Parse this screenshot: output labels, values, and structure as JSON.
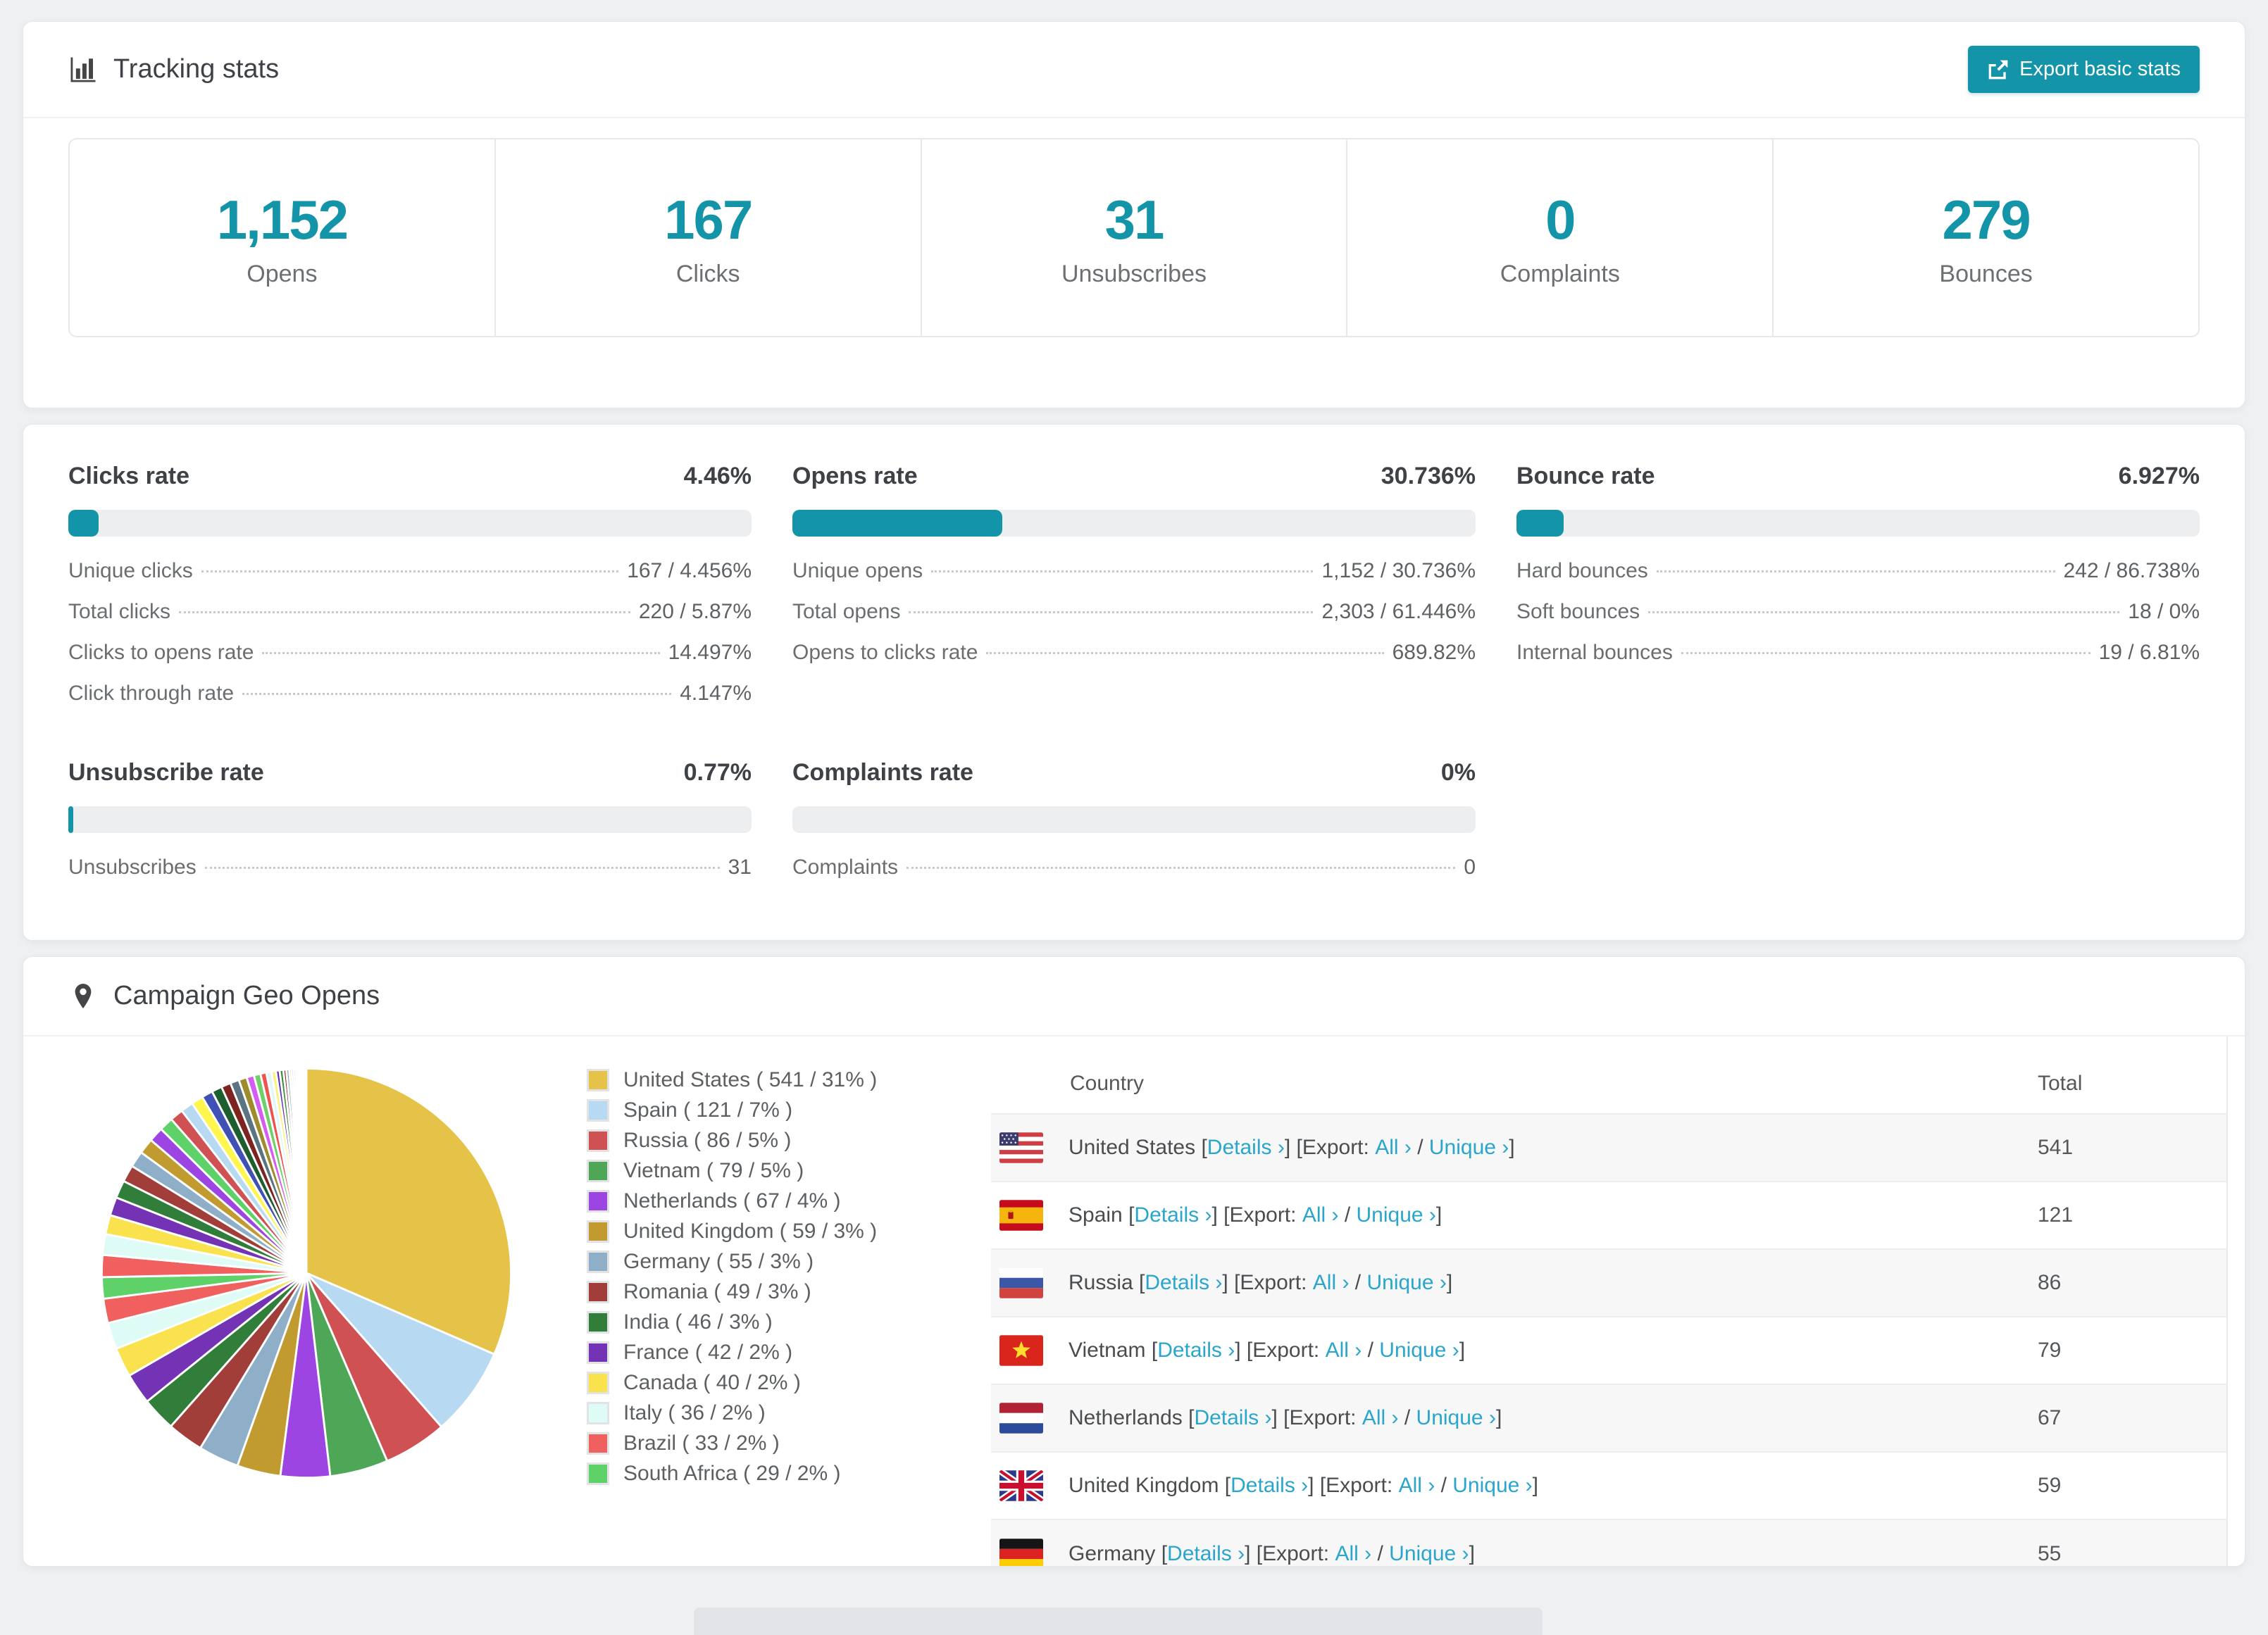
{
  "colors": {
    "accent": "#1494a9",
    "link": "#2aa5cb"
  },
  "header": {
    "title": "Tracking stats",
    "export_label": "Export basic stats"
  },
  "stats": [
    {
      "value": "1,152",
      "label": "Opens"
    },
    {
      "value": "167",
      "label": "Clicks"
    },
    {
      "value": "31",
      "label": "Unsubscribes"
    },
    {
      "value": "0",
      "label": "Complaints"
    },
    {
      "value": "279",
      "label": "Bounces"
    }
  ],
  "rates": {
    "clicks": {
      "title": "Clicks rate",
      "value": "4.46%",
      "pct": 4.46,
      "rows": [
        {
          "label": "Unique clicks",
          "value": "167 / 4.456%"
        },
        {
          "label": "Total clicks",
          "value": "220 / 5.87%"
        },
        {
          "label": "Clicks to opens rate",
          "value": "14.497%"
        },
        {
          "label": "Click through rate",
          "value": "4.147%"
        }
      ]
    },
    "opens": {
      "title": "Opens rate",
      "value": "30.736%",
      "pct": 30.736,
      "rows": [
        {
          "label": "Unique opens",
          "value": "1,152 / 30.736%"
        },
        {
          "label": "Total opens",
          "value": "2,303 / 61.446%"
        },
        {
          "label": "Opens to clicks rate",
          "value": "689.82%"
        }
      ]
    },
    "bounces": {
      "title": "Bounce rate",
      "value": "6.927%",
      "pct": 6.927,
      "rows": [
        {
          "label": "Hard bounces",
          "value": "242 / 86.738%"
        },
        {
          "label": "Soft bounces",
          "value": "18 / 0%"
        },
        {
          "label": "Internal bounces",
          "value": "19 / 6.81%"
        }
      ]
    },
    "unsubscribe": {
      "title": "Unsubscribe rate",
      "value": "0.77%",
      "pct": 0.77,
      "rows": [
        {
          "label": "Unsubscribes",
          "value": "31"
        }
      ]
    },
    "complaints": {
      "title": "Complaints rate",
      "value": "0%",
      "pct": 0,
      "rows": [
        {
          "label": "Complaints",
          "value": "0"
        }
      ]
    }
  },
  "geo": {
    "title": "Campaign Geo Opens",
    "table": {
      "columns": [
        "Country",
        "Total"
      ],
      "details_label": "Details",
      "export_label": "Export:",
      "all_label": "All",
      "unique_label": "Unique",
      "rows": [
        {
          "code": "us",
          "country": "United States",
          "total": "541"
        },
        {
          "code": "es",
          "country": "Spain",
          "total": "121"
        },
        {
          "code": "ru",
          "country": "Russia",
          "total": "86"
        },
        {
          "code": "vn",
          "country": "Vietnam",
          "total": "79"
        },
        {
          "code": "nl",
          "country": "Netherlands",
          "total": "67"
        },
        {
          "code": "gb",
          "country": "United Kingdom",
          "total": "59"
        },
        {
          "code": "de",
          "country": "Germany",
          "total": "55"
        }
      ]
    }
  },
  "chart_data": {
    "type": "pie",
    "title": "Campaign Geo Opens",
    "legend_position": "right",
    "start_angle": "top, clockwise",
    "slices": [
      {
        "label": "United States",
        "value": 541,
        "pct": 31,
        "color": "#e5c348"
      },
      {
        "label": "Spain",
        "value": 121,
        "pct": 7,
        "color": "#b7d9f2"
      },
      {
        "label": "Russia",
        "value": 86,
        "pct": 5,
        "color": "#cf5153"
      },
      {
        "label": "Vietnam",
        "value": 79,
        "pct": 5,
        "color": "#4ea757"
      },
      {
        "label": "Netherlands",
        "value": 67,
        "pct": 4,
        "color": "#9d45e3"
      },
      {
        "label": "United Kingdom",
        "value": 59,
        "pct": 3,
        "color": "#c19a30"
      },
      {
        "label": "Germany",
        "value": 55,
        "pct": 3,
        "color": "#8fafc9"
      },
      {
        "label": "Romania",
        "value": 49,
        "pct": 3,
        "color": "#a23e3a"
      },
      {
        "label": "India",
        "value": 46,
        "pct": 3,
        "color": "#317d3a"
      },
      {
        "label": "France",
        "value": 42,
        "pct": 2,
        "color": "#7433b5"
      },
      {
        "label": "Canada",
        "value": 40,
        "pct": 2,
        "color": "#fae14e"
      },
      {
        "label": "Italy",
        "value": 36,
        "pct": 2,
        "color": "#dffbf5"
      },
      {
        "label": "Brazil",
        "value": 33,
        "pct": 2,
        "color": "#f0605f"
      },
      {
        "label": "South Africa",
        "value": 29,
        "pct": 2,
        "color": "#5fd169"
      }
    ],
    "other_slices": [
      {
        "value": 30,
        "color": "#f0605f"
      },
      {
        "value": 28,
        "color": "#dffbf5"
      },
      {
        "value": 26,
        "color": "#fae14e"
      },
      {
        "value": 25,
        "color": "#7433b5"
      },
      {
        "value": 24,
        "color": "#317d3a"
      },
      {
        "value": 23,
        "color": "#a23e3a"
      },
      {
        "value": 22,
        "color": "#8fafc9"
      },
      {
        "value": 21,
        "color": "#c19a30"
      },
      {
        "value": 20,
        "color": "#9d45e3"
      },
      {
        "value": 19,
        "color": "#5fd169"
      },
      {
        "value": 18,
        "color": "#cf5153"
      },
      {
        "value": 17,
        "color": "#b7d9f2"
      },
      {
        "value": 16,
        "color": "#fff64d"
      },
      {
        "value": 15,
        "color": "#3f51b5"
      },
      {
        "value": 14,
        "color": "#1d5e2f"
      },
      {
        "value": 13,
        "color": "#7d2420"
      },
      {
        "value": 12,
        "color": "#5c7482"
      },
      {
        "value": 11,
        "color": "#9e8b2c"
      },
      {
        "value": 10,
        "color": "#d45cf0"
      },
      {
        "value": 9,
        "color": "#6fcf69"
      },
      {
        "value": 8,
        "color": "#ef5350"
      },
      {
        "value": 7,
        "color": "#e0f7fa"
      },
      {
        "value": 6,
        "color": "#fff176"
      },
      {
        "value": 5,
        "color": "#5e35b1"
      },
      {
        "value": 5,
        "color": "#388e3c"
      },
      {
        "value": 4,
        "color": "#8e2f2b"
      },
      {
        "value": 4,
        "color": "#90a4ae"
      },
      {
        "value": 3,
        "color": "#c0a02e"
      },
      {
        "value": 3,
        "color": "#aa6ce8"
      },
      {
        "value": 3,
        "color": "#81c784"
      },
      {
        "value": 2,
        "color": "#ef9a9a"
      },
      {
        "value": 2,
        "color": "#b2ebf2"
      },
      {
        "value": 2,
        "color": "#fff59d"
      },
      {
        "value": 2,
        "color": "#7e57c2"
      },
      {
        "value": 1,
        "color": "#43a047"
      },
      {
        "value": 1,
        "color": "#a03b39"
      },
      {
        "value": 1,
        "color": "#b0bec5"
      },
      {
        "value": 1,
        "color": "#d4b82e"
      },
      {
        "value": 1,
        "color": "#ce93d8"
      },
      {
        "value": 1,
        "color": "#a5d6a7"
      }
    ]
  }
}
